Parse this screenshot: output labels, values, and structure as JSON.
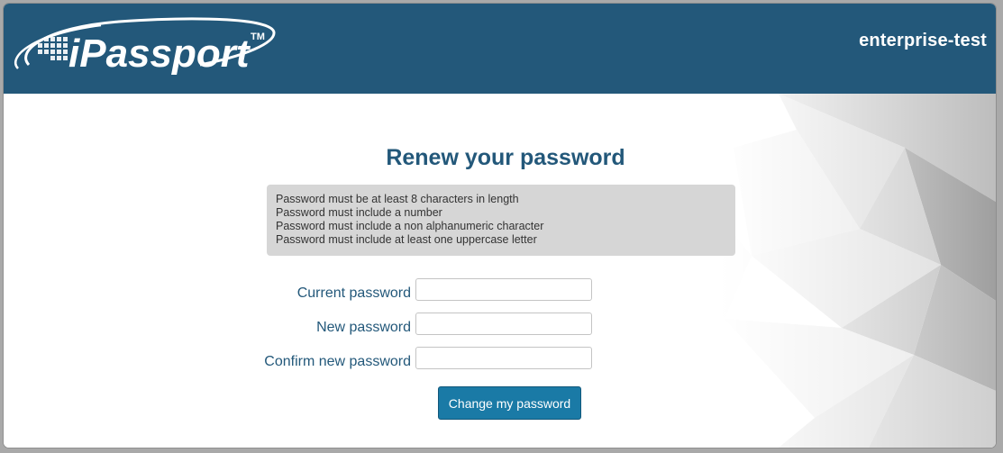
{
  "header": {
    "logo_text": "iPassport",
    "logo_tm": "TM",
    "tenant_name": "enterprise-test"
  },
  "form": {
    "title": "Renew your password",
    "rules": [
      "Password must be at least 8 characters in length",
      "Password must include a number",
      "Password must include a non alphanumeric character",
      "Password must include at least one uppercase letter"
    ],
    "fields": [
      {
        "label": "Current password",
        "value": "",
        "type": "password"
      },
      {
        "label": "New password",
        "value": "",
        "type": "password"
      },
      {
        "label": "Confirm new password",
        "value": "",
        "type": "password"
      }
    ],
    "submit_label": "Change my password"
  },
  "colors": {
    "header_bg": "#23587a",
    "title": "#23587a",
    "button_bg": "#1a7aa6",
    "rules_bg": "#d6d6d6"
  }
}
